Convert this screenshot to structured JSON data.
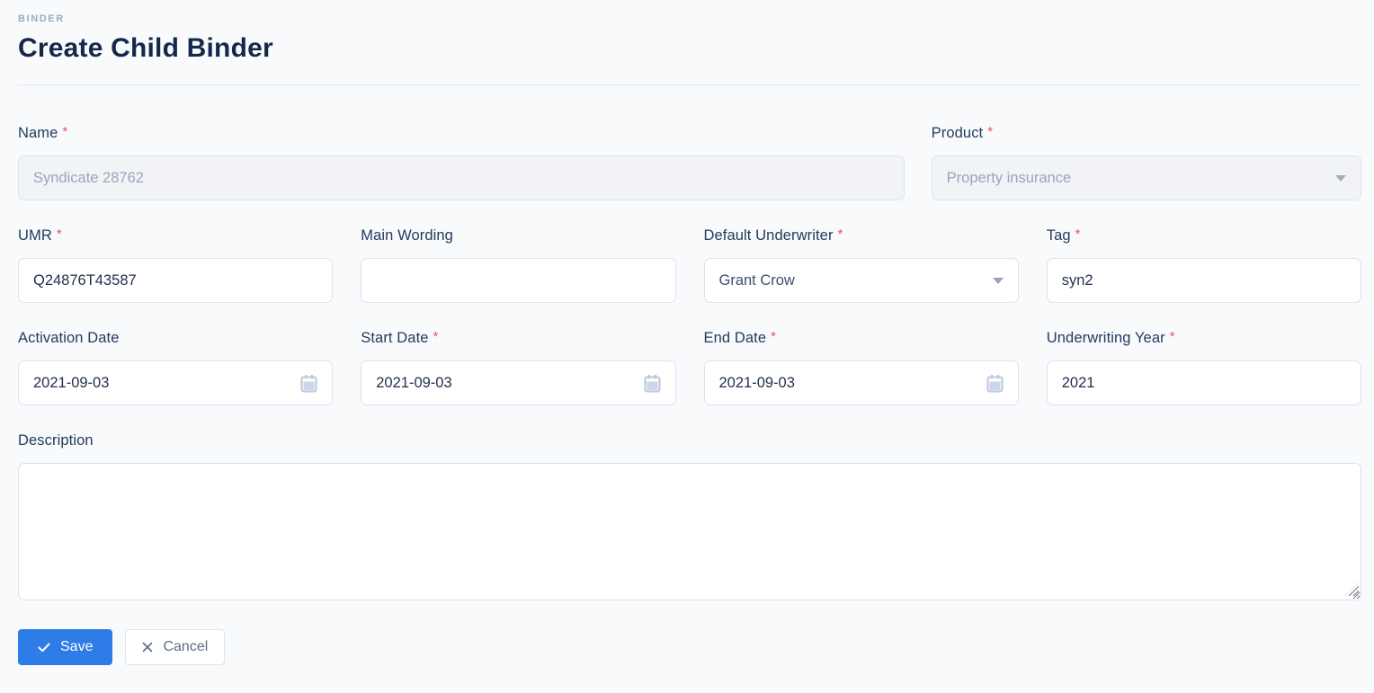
{
  "header": {
    "breadcrumb": "BINDER",
    "title": "Create Child Binder"
  },
  "form": {
    "required_marker": "*",
    "fields": {
      "name": {
        "label": "Name",
        "value": "Syndicate 28762",
        "disabled": true
      },
      "product": {
        "label": "Product",
        "value": "Property insurance",
        "disabled": true
      },
      "umr": {
        "label": "UMR",
        "value": "Q24876T43587"
      },
      "main_wording": {
        "label": "Main Wording",
        "value": "",
        "placeholder": ""
      },
      "default_underwriter": {
        "label": "Default Underwriter",
        "value": "Grant Crow"
      },
      "tag": {
        "label": "Tag",
        "value": "syn2"
      },
      "activation_date": {
        "label": "Activation Date",
        "value": "2021-09-03"
      },
      "start_date": {
        "label": "Start Date",
        "value": "2021-09-03"
      },
      "end_date": {
        "label": "End Date",
        "value": "2021-09-03"
      },
      "underwriting_year": {
        "label": "Underwriting Year",
        "value": "2021"
      },
      "description": {
        "label": "Description",
        "value": ""
      }
    }
  },
  "actions": {
    "save_label": "Save",
    "cancel_label": "Cancel"
  },
  "icons": {
    "save": "check-icon",
    "cancel": "x-icon",
    "date_fields": "calendar-icon",
    "dropdowns": "chevron-down-icon"
  },
  "colors": {
    "page_background": "#f8fafc",
    "primary_blue": "#2e7ce8",
    "required_red": "#e0566a",
    "title_navy": "#16284a",
    "breadcrumb_gray": "#9aa9c2",
    "input_border": "#dbe2ee",
    "disabled_background": "#f1f3f7",
    "disabled_text": "#9aa5ba"
  }
}
